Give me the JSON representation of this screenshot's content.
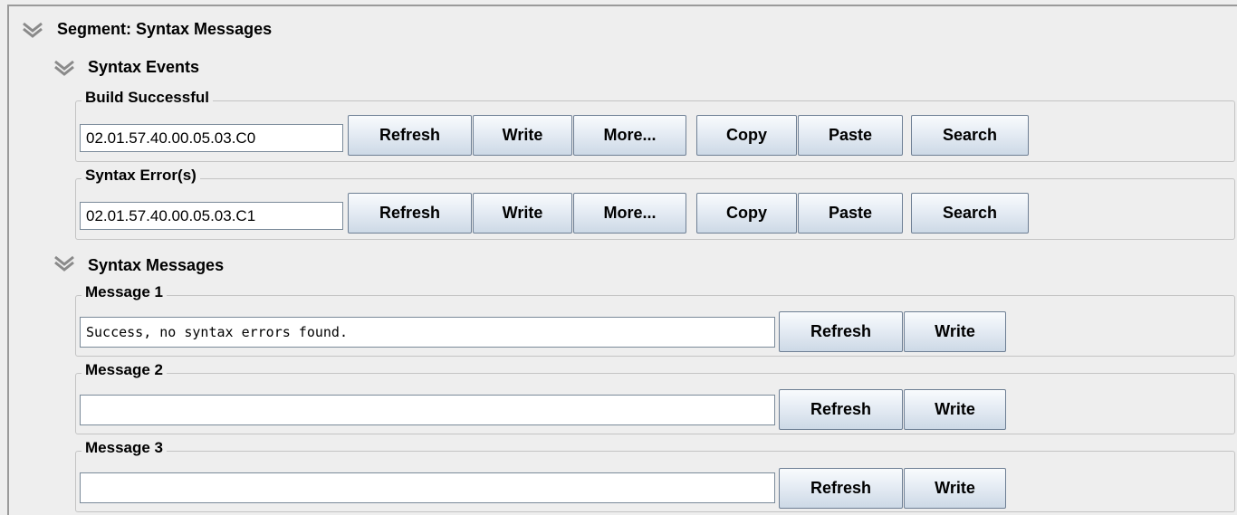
{
  "segment": {
    "title": "Segment: Syntax Messages"
  },
  "syntax_events": {
    "title": "Syntax Events",
    "groups": [
      {
        "label": "Build Successful",
        "value": "02.01.57.40.00.05.03.C0",
        "buttons": [
          "Refresh",
          "Write",
          "More...",
          "Copy",
          "Paste",
          "Search"
        ]
      },
      {
        "label": "Syntax Error(s)",
        "value": "02.01.57.40.00.05.03.C1",
        "buttons": [
          "Refresh",
          "Write",
          "More...",
          "Copy",
          "Paste",
          "Search"
        ]
      }
    ]
  },
  "syntax_messages": {
    "title": "Syntax Messages",
    "groups": [
      {
        "label": "Message 1",
        "value": "Success, no syntax errors found.",
        "buttons": [
          "Refresh",
          "Write"
        ]
      },
      {
        "label": "Message 2",
        "value": "",
        "buttons": [
          "Refresh",
          "Write"
        ]
      },
      {
        "label": "Message 3",
        "value": "",
        "buttons": [
          "Refresh",
          "Write"
        ]
      }
    ]
  },
  "icons": {
    "collapse": "double-chevron-down-icon"
  }
}
